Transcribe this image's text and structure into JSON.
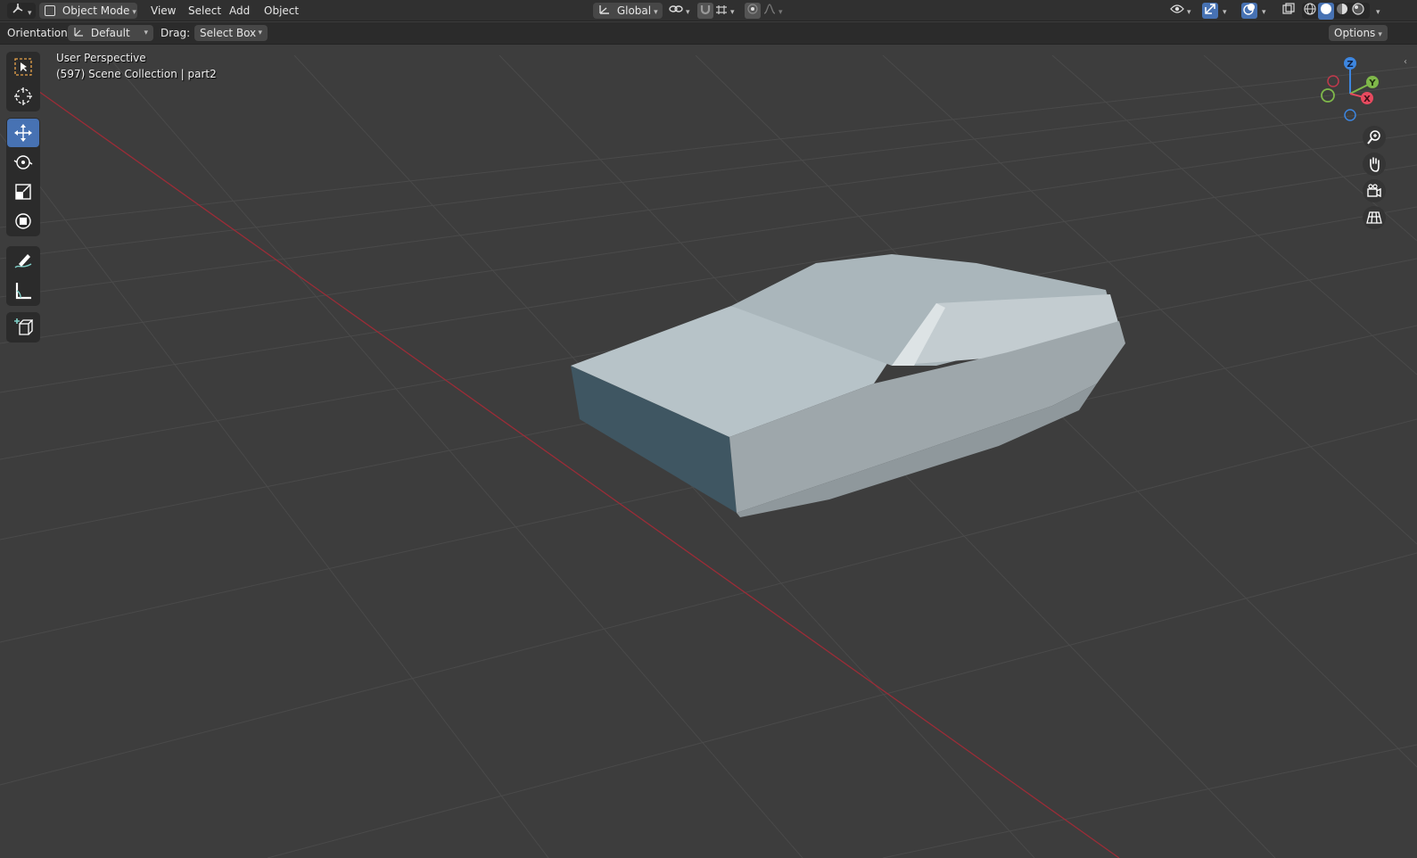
{
  "header": {
    "editor_type_icon": "3d-viewport-icon",
    "mode": "Object Mode",
    "menus": [
      "View",
      "Select",
      "Add",
      "Object"
    ],
    "transform_orientation": "Global"
  },
  "tool_header": {
    "orientation_label": "Orientation:",
    "orientation_value": "Default",
    "drag_label": "Drag:",
    "drag_value": "Select Box",
    "options_label": "Options"
  },
  "viewport": {
    "view_name": "User Perspective",
    "collection_info": "(597) Scene Collection | part2",
    "gizmo_axes": [
      "Z",
      "Y",
      "X"
    ],
    "colors": {
      "background": "#3d3d3d",
      "grid": "#4a4a4a",
      "x_axis": "#9b2c37",
      "axis_x": "#e84a5f",
      "axis_y": "#7fb84a",
      "axis_z": "#3d86e0",
      "active_tool": "#4772b3"
    }
  },
  "toolbar": {
    "tools": [
      "select-box",
      "cursor",
      "move",
      "rotate",
      "scale",
      "transform",
      "annotate",
      "measure",
      "add-cube"
    ],
    "active_tool": "move"
  },
  "navigation": [
    "zoom",
    "pan",
    "camera",
    "perspective-toggle"
  ]
}
